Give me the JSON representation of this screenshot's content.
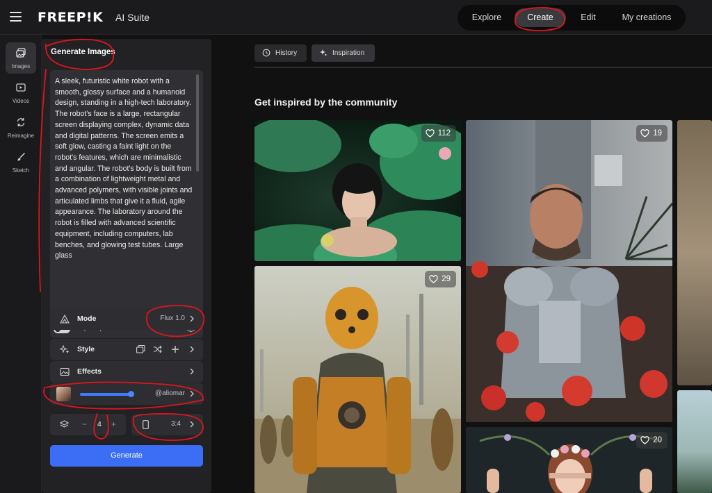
{
  "app": {
    "logo": "FREEP!K",
    "suite": "AI Suite"
  },
  "nav": {
    "items": [
      {
        "label": "Explore"
      },
      {
        "label": "Create",
        "active": true
      },
      {
        "label": "Edit"
      },
      {
        "label": "My creations"
      }
    ]
  },
  "rail": {
    "items": [
      {
        "label": "Images",
        "icon": "images-icon",
        "active": true
      },
      {
        "label": "Videos",
        "icon": "video-icon"
      },
      {
        "label": "Reimagine",
        "icon": "reimagine-icon"
      },
      {
        "label": "Sketch",
        "icon": "brush-icon"
      }
    ]
  },
  "panel": {
    "title": "Generate Images",
    "prompt": "A sleek, futuristic white robot with a smooth, glossy surface and a humanoid design, standing in a high-tech laboratory. The robot's face is a large, rectangular screen displaying complex, dynamic data and digital patterns. The screen emits a soft glow, casting a faint light on the robot's features, which are minimalistic and angular. The robot's body is built from a combination of lightweight metal and advanced polymers, with visible joints and articulated limbs that give it a fluid, agile appearance. The laboratory around the robot is filled with advanced scientific equipment, including computers, lab benches, and glowing test tubes. Large glass",
    "ai_prompt_label": "AI-prompt",
    "ai_prompt_enabled": false,
    "mode": {
      "label": "Mode",
      "value": "Flux 1.0"
    },
    "style": {
      "label": "Style"
    },
    "effects": {
      "label": "Effects"
    },
    "character": {
      "value": "@aliomar",
      "strength": 0.9
    },
    "count": {
      "minus": "−",
      "value": "4",
      "plus": "+"
    },
    "ratio": {
      "value": "3:4"
    },
    "generate_label": "Generate"
  },
  "content": {
    "tabs": [
      {
        "label": "History",
        "icon": "history-icon"
      },
      {
        "label": "Inspiration",
        "icon": "sparkle-icon",
        "active": true
      }
    ],
    "heading": "Get inspired by the community",
    "cards": [
      {
        "likes": "112",
        "subject": "woman among lotus leaves"
      },
      {
        "likes": "29",
        "subject": "rusty orange robot"
      },
      {
        "likes": "19",
        "subject": "man in armor with red poppies"
      },
      {
        "likes": "20",
        "subject": "woman with flower crown"
      }
    ]
  },
  "colors": {
    "accent": "#3b6ef5",
    "annotation": "#e0141e",
    "background": "#111112"
  }
}
